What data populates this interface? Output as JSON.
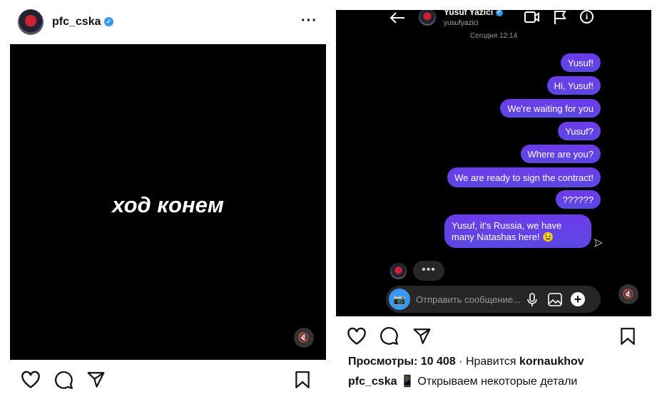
{
  "left_post": {
    "username": "pfc_cska",
    "more_icon": "more-horizontal-icon",
    "image_text": "ход конем"
  },
  "dm": {
    "contact_name": "Yusuf Yazıcı",
    "contact_username": "yusufyazici",
    "timestamp": "Сегодня 12:14",
    "messages": [
      {
        "text": "Yusuf!"
      },
      {
        "text": "Hi, Yusuf!"
      },
      {
        "text": "We're waiting for you"
      },
      {
        "text": "Yusuf?"
      },
      {
        "text": "Where are you?"
      },
      {
        "text": "We are ready to sign the contract!"
      },
      {
        "text": "??????"
      },
      {
        "text": "Yusuf, it's Russia, we have many Natashas here! 😉"
      }
    ],
    "typing_dots": "•••",
    "input_placeholder": "Отправить сообщение...",
    "bubble_color": "#6e3bea"
  },
  "right_post": {
    "views_label": "Просмотры: 10 408",
    "separator": "·",
    "liked_prefix": "Нравится",
    "liked_by": "kornaukhov",
    "caption_user": "pfc_cska",
    "caption_emoji": "📱",
    "caption_text": "Открываем некоторые детали"
  }
}
